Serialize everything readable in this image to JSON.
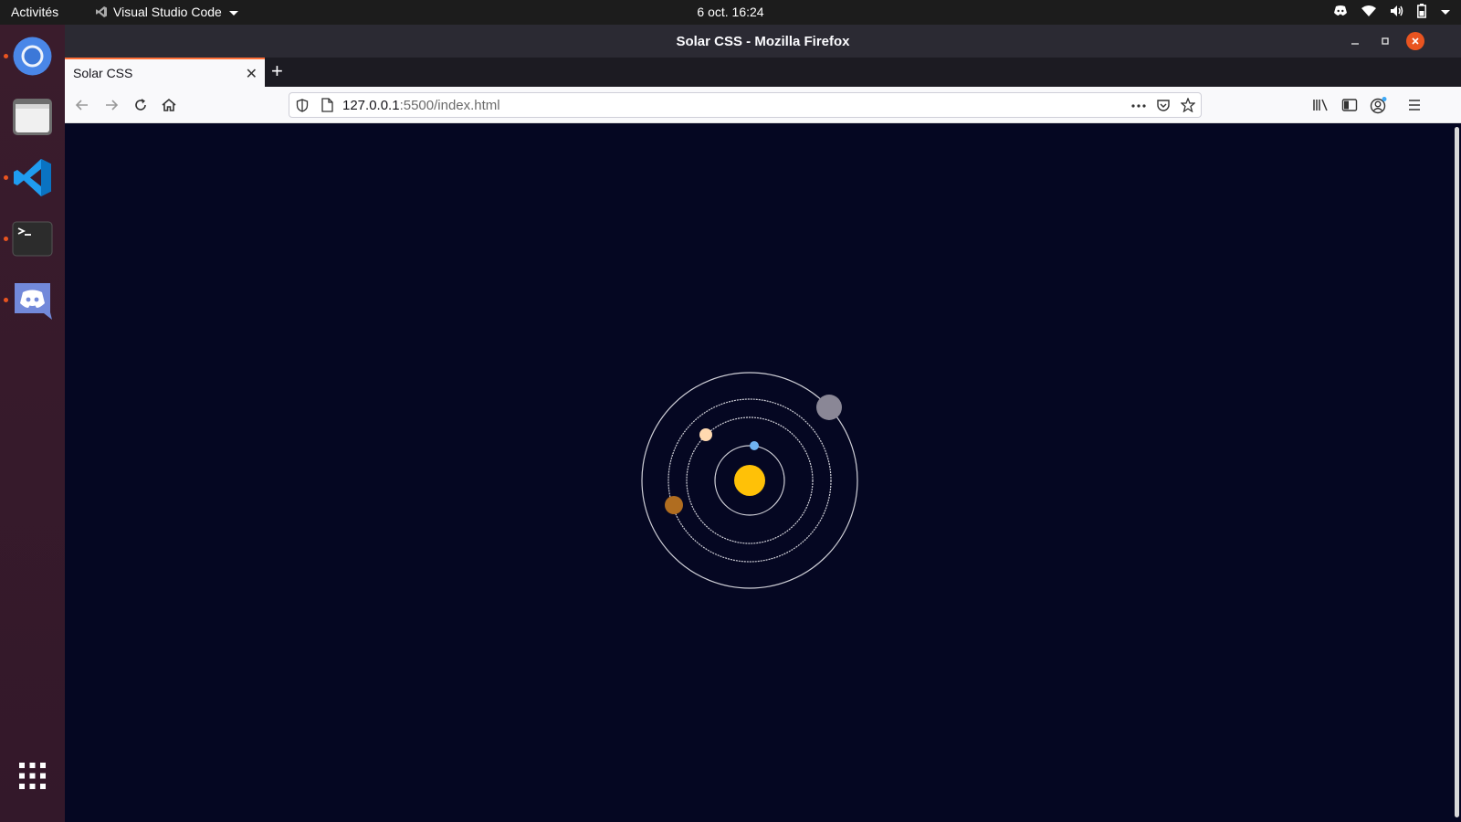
{
  "topbar": {
    "activities": "Activités",
    "app_name": "Visual Studio Code",
    "clock": "6 oct.  16:24",
    "tray_icons": [
      "discord-tray-icon",
      "wifi-icon",
      "volume-icon",
      "battery-icon",
      "system-menu-caret-icon"
    ]
  },
  "dock": {
    "items": [
      {
        "name": "chrome",
        "running": true
      },
      {
        "name": "files",
        "running": false
      },
      {
        "name": "vscode",
        "running": true
      },
      {
        "name": "terminal",
        "running": true
      },
      {
        "name": "discord",
        "running": true
      }
    ],
    "show_apps": "show-applications-icon",
    "accent": "#e95420"
  },
  "window": {
    "title": "Solar CSS - Mozilla Firefox",
    "tab": {
      "label": "Solar CSS"
    },
    "url": {
      "host": "127.0.0.1",
      "rest": ":5500/index.html"
    },
    "accent": "#ff7139"
  },
  "page": {
    "background": "#050722",
    "sun_color": "#ffc107",
    "planets": [
      {
        "color": "#6fb2f0",
        "orbit": 1
      },
      {
        "color": "#ffd9b0",
        "orbit": 2
      },
      {
        "color": "#b06d20",
        "orbit": 3
      },
      {
        "color": "#8a8796",
        "orbit": 4
      }
    ]
  }
}
